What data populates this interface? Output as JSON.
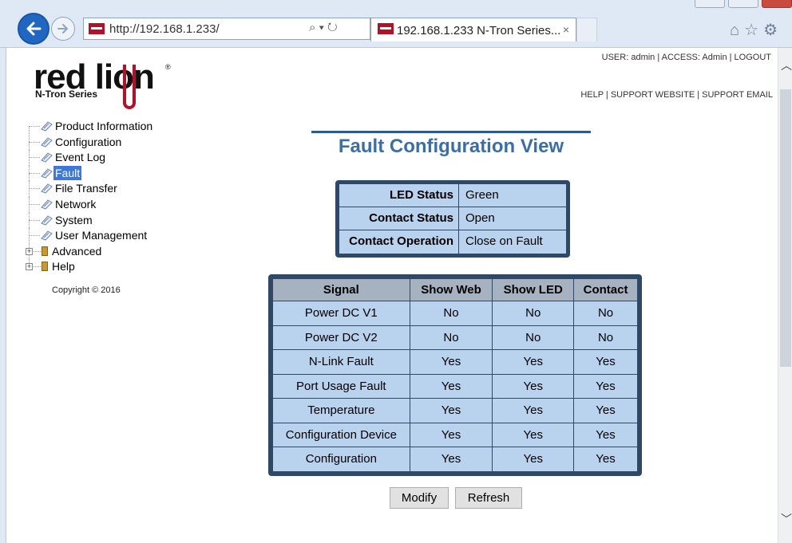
{
  "browser": {
    "url": "http://192.168.1.233/",
    "tab_title": "192.168.1.233 N-Tron Series...",
    "tab_close": "×",
    "address_icons": "⌕ ▾ ↻"
  },
  "brand": {
    "logo_text": "red lion",
    "logo_reg": "®",
    "series": "N-Tron Series",
    "brand_color": "#b5102a"
  },
  "header": {
    "user_bar": "USER: admin | ACCESS: Admin | LOGOUT",
    "help_bar": "HELP | SUPPORT WEBSITE | SUPPORT EMAIL"
  },
  "nav": {
    "items": [
      {
        "label": "Product Information"
      },
      {
        "label": "Configuration"
      },
      {
        "label": "Event Log"
      },
      {
        "label": "Fault"
      },
      {
        "label": "File Transfer"
      },
      {
        "label": "Network"
      },
      {
        "label": "System"
      },
      {
        "label": "User Management"
      },
      {
        "label": "Advanced"
      },
      {
        "label": "Help"
      }
    ],
    "copyright": "Copyright © 2016"
  },
  "main": {
    "title": "Fault Configuration View",
    "status": [
      {
        "label": "LED Status",
        "value": "Green"
      },
      {
        "label": "Contact Status",
        "value": "Open"
      },
      {
        "label": "Contact Operation",
        "value": "Close on Fault"
      }
    ],
    "table": {
      "headers": [
        "Signal",
        "Show Web",
        "Show LED",
        "Contact"
      ],
      "rows": [
        [
          "Power DC V1",
          "No",
          "No",
          "No"
        ],
        [
          "Power DC V2",
          "No",
          "No",
          "No"
        ],
        [
          "N-Link Fault",
          "Yes",
          "Yes",
          "Yes"
        ],
        [
          "Port Usage Fault",
          "Yes",
          "Yes",
          "Yes"
        ],
        [
          "Temperature",
          "Yes",
          "Yes",
          "Yes"
        ],
        [
          "Configuration Device",
          "Yes",
          "Yes",
          "Yes"
        ],
        [
          "Configuration",
          "Yes",
          "Yes",
          "Yes"
        ]
      ]
    },
    "buttons": {
      "modify": "Modify",
      "refresh": "Refresh"
    }
  }
}
